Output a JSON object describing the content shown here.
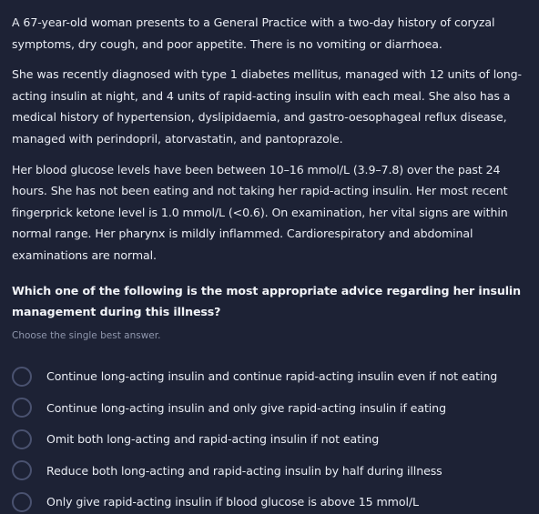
{
  "stem": {
    "paragraphs": [
      "A 67-year-old woman presents to a General Practice with a two-day history of coryzal symptoms, dry cough, and poor appetite. There is no vomiting or diarrhoea.",
      "She was recently diagnosed with type 1 diabetes mellitus, managed with 12 units of long-acting insulin at night, and 4 units of rapid-acting insulin with each meal. She also has a medical history of hypertension, dyslipidaemia, and gastro-oesophageal reflux disease, managed with perindopril, atorvastatin, and pantoprazole.",
      "Her blood glucose levels have been between 10–16 mmol/L (3.9–7.8) over the past 24 hours. She has not been eating and not taking her rapid-acting insulin. Her most recent fingerprick ketone level is 1.0 mmol/L (<0.6). On examination, her vital signs are within normal range. Her pharynx is mildly inflammed. Cardiorespiratory and abdominal examinations are normal."
    ]
  },
  "question": {
    "text": "Which one of the following is the most appropriate advice regarding her insulin management during this illness?",
    "hint": "Choose the single best answer."
  },
  "options": [
    {
      "label": "Continue long-acting insulin and continue rapid-acting insulin even if not eating",
      "selected": false
    },
    {
      "label": "Continue long-acting insulin and only give rapid-acting insulin if eating",
      "selected": false
    },
    {
      "label": "Omit both long-acting and rapid-acting insulin if not eating",
      "selected": false
    },
    {
      "label": "Reduce both long-acting and rapid-acting insulin by half during illness",
      "selected": false
    },
    {
      "label": "Only give rapid-acting insulin if blood glucose is above 15 mmol/L",
      "selected": false
    }
  ],
  "colors": {
    "background": "#1d2235",
    "text": "#e9ecf3",
    "hint": "#8f97ad",
    "radio_border": "#4a5270"
  }
}
